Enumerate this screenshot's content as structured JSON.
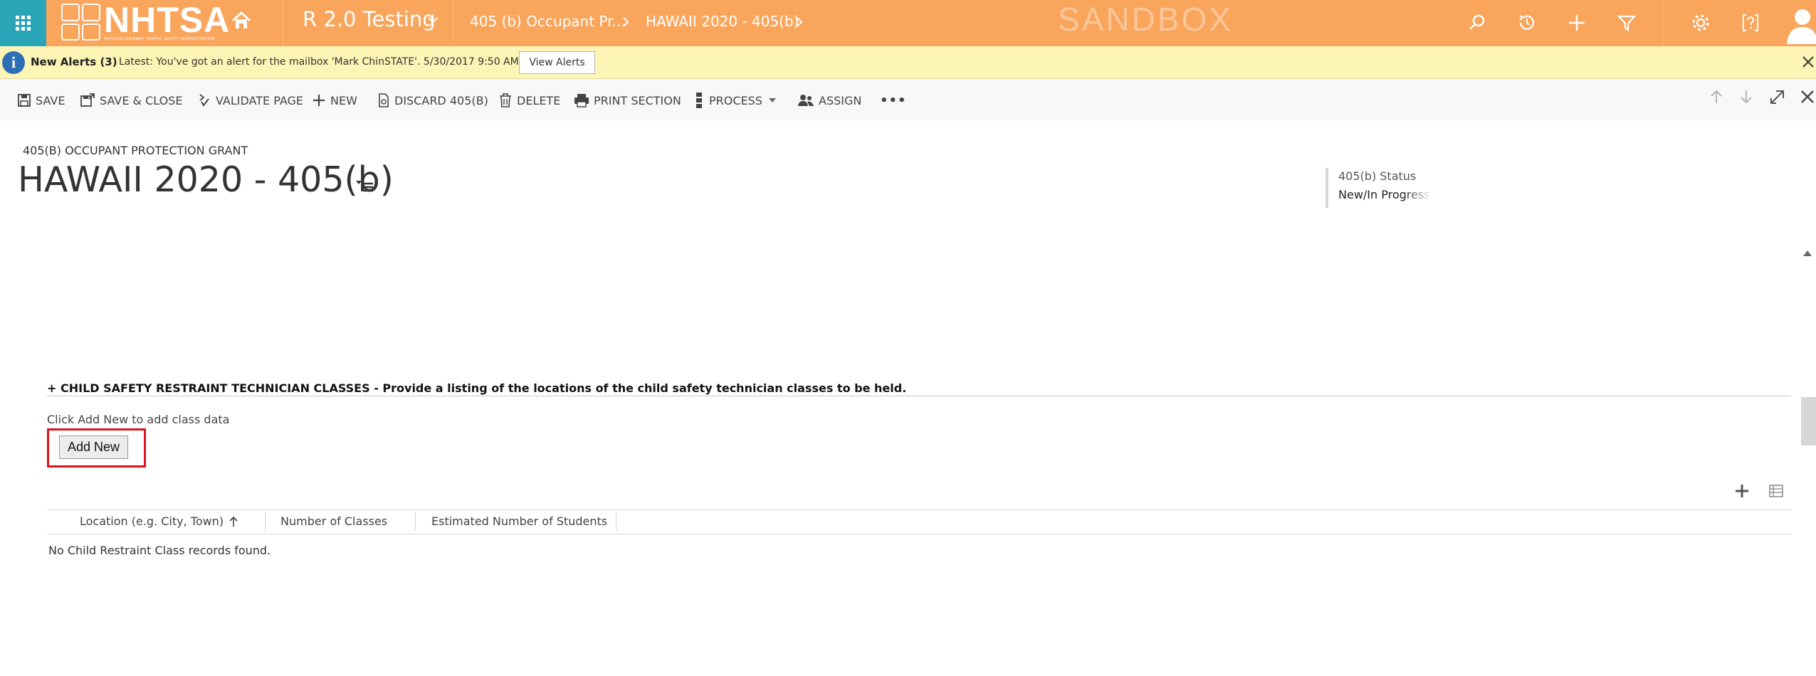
{
  "nav": {
    "logo_text": "NHTSA",
    "logo_subtext": "NATIONAL HIGHWAY TRAFFIC SAFETY ADMINISTRATION",
    "app_name": "R 2.0 Testing",
    "breadcrumbs": [
      "405 (b) Occupant Pr...",
      "HAWAII 2020 - 405(b)"
    ],
    "environment": "SANDBOX",
    "colors": {
      "bar": "#f9a55c",
      "waffle": "#2aa5b8"
    }
  },
  "alert": {
    "title": "New Alerts (3)",
    "message": "Latest: You've got an alert for the mailbox 'Mark ChinSTATE'. 5/30/2017 9:50 AM",
    "button": "View Alerts"
  },
  "commands": {
    "save": "SAVE",
    "save_close": "SAVE & CLOSE",
    "validate": "VALIDATE PAGE",
    "new": "NEW",
    "discard": "DISCARD 405(B)",
    "delete": "DELETE",
    "print": "PRINT SECTION",
    "process": "PROCESS",
    "assign": "ASSIGN",
    "more": "•••"
  },
  "header": {
    "entity_type": "405(B) OCCUPANT PROTECTION GRANT",
    "record_title": "HAWAII 2020 - 405(b)",
    "status_label": "405(b) Status",
    "status_value": "New/In Progress"
  },
  "section": {
    "title": "+ CHILD SAFETY RESTRAINT TECHNICIAN CLASSES - Provide a listing of the locations of the child safety technician classes to be held.",
    "hint": "Click Add New to add class data",
    "add_button": "Add New",
    "columns": [
      "Location (e.g. City, Town)",
      "Number of Classes",
      "Estimated Number of Students"
    ],
    "empty_message": "No Child Restraint Class records found."
  }
}
